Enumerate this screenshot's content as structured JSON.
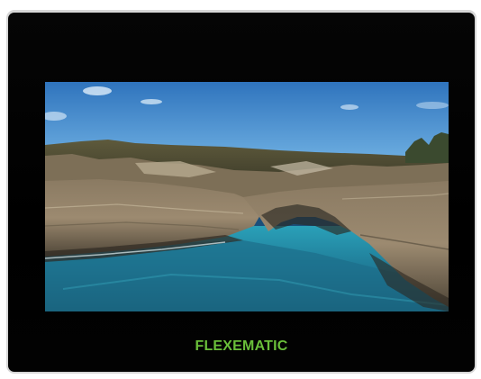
{
  "brand": {
    "text": "FLEXEMATIC",
    "color": "#6abf3a"
  },
  "photo": {
    "subject-icon": "coastal-rock-arch-photo",
    "sky_color": "#3f86c8",
    "water_color": "#1f6f8f"
  }
}
